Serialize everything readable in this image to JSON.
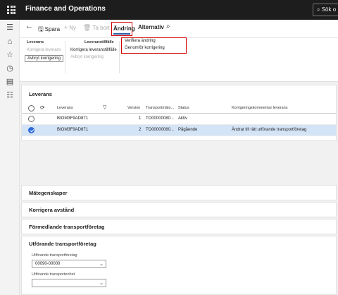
{
  "app": {
    "title": "Finance and Operations",
    "search_label": "Sök o"
  },
  "actionbar": {
    "save": "Spara",
    "new": "Ny",
    "delete": "Ta bort",
    "tab_change": "Ändring",
    "tab_options": "Alternativ"
  },
  "ribbon": {
    "group_delivery": {
      "title": "Leverans",
      "correct_delivery": "Korrigera leverans",
      "cancel_correction": "Avbryt korrigering"
    },
    "group_occasion": {
      "title": "Leveranstillfälle",
      "correct_occasion": "Korrigera leveranstillfälle",
      "cancel_correction": "Avbryt korrigering"
    },
    "group_change": {
      "verify_change": "Verifiera ändring",
      "perform_correction": "Genomför korrigering"
    }
  },
  "leverans": {
    "section_title": "Leverans",
    "columns": [
      "Leverans",
      "Version",
      "Transportmäto...",
      "Status",
      "Korrigeringskommentar leverans"
    ],
    "rows": [
      {
        "leverans": "BIOM3F9AD871",
        "version": "1",
        "transport": "TO00000080...",
        "status": "Aktiv",
        "comment": "",
        "selected": false
      },
      {
        "leverans": "BIOM3F9AD871",
        "version": "2",
        "transport": "TO00000080...",
        "status": "Pågående",
        "comment": "Ändrat till rätt utförande transportföretag",
        "selected": true
      }
    ]
  },
  "sections": {
    "mategenskaper": "Mätegenskaper",
    "korrigera_avstand": "Korrigera avstånd",
    "formedlande": "Förmedlande transportföretag",
    "utforande": "Utförande transportföretag"
  },
  "utforande_fields": {
    "company_label": "Utförande transportföretag",
    "company_value": "00090-00000",
    "unit_label": "Utförande transportenhet",
    "unit_value": ""
  },
  "colors": {
    "titlebar": "#1d1d1d",
    "highlight_border": "#d10000",
    "selected_row": "#d4e4f7",
    "accent": "#2a6ad8"
  },
  "icons": [
    "waffle-icon",
    "search-icon",
    "hamburger-icon",
    "home-icon",
    "star-icon",
    "clock-icon",
    "workspaces-icon",
    "list-icon",
    "back-arrow-icon",
    "save-icon",
    "plus-icon",
    "trash-icon",
    "filter-icon",
    "refresh-icon",
    "chevron-down-icon"
  ]
}
